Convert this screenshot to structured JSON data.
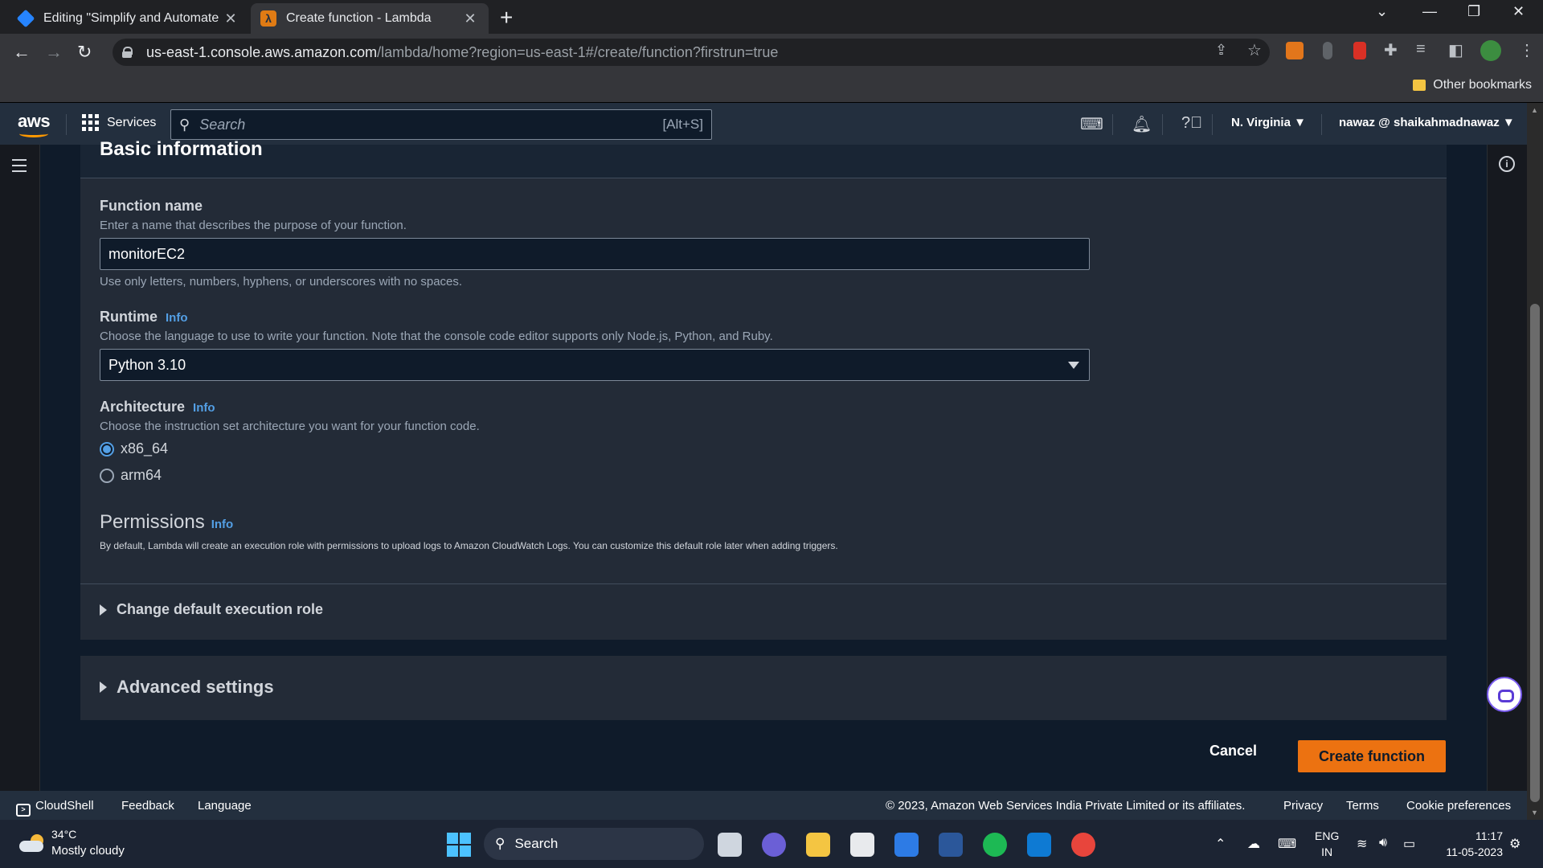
{
  "browser": {
    "tabs": [
      {
        "label": "Editing \"Simplify and Automate /",
        "active": false,
        "favicon": "confluence-icon"
      },
      {
        "label": "Create function - Lambda",
        "active": true,
        "favicon": "lambda-icon"
      }
    ],
    "url_host": "us-east-1.console.aws.amazon.com",
    "url_path": "/lambda/home?region=us-east-1#/create/function?firstrun=true",
    "bookmarks": {
      "other": "Other bookmarks"
    }
  },
  "aws_header": {
    "logo": "aws",
    "services": "Services",
    "search_placeholder": "Search",
    "search_shortcut": "[Alt+S]",
    "region": "N. Virginia",
    "account": "nawaz @ shaikahmadnawaz"
  },
  "form": {
    "section_title": "Basic information",
    "function_name": {
      "label": "Function name",
      "description": "Enter a name that describes the purpose of your function.",
      "value": "monitorEC2",
      "constraint": "Use only letters, numbers, hyphens, or underscores with no spaces."
    },
    "runtime": {
      "label": "Runtime",
      "info": "Info",
      "description": "Choose the language to use to write your function. Note that the console code editor supports only Node.js, Python, and Ruby.",
      "value": "Python 3.10"
    },
    "architecture": {
      "label": "Architecture",
      "info": "Info",
      "description": "Choose the instruction set architecture you want for your function code.",
      "options": [
        {
          "label": "x86_64",
          "selected": true
        },
        {
          "label": "arm64",
          "selected": false
        }
      ]
    },
    "permissions": {
      "title": "Permissions",
      "info": "Info",
      "description": "By default, Lambda will create an execution role with permissions to upload logs to Amazon CloudWatch Logs. You can customize this default role later when adding triggers.",
      "expander": "Change default execution role"
    },
    "advanced": "Advanced settings",
    "cancel": "Cancel",
    "create": "Create function"
  },
  "footer": {
    "cloudshell": "CloudShell",
    "feedback": "Feedback",
    "language": "Language",
    "copyright": "© 2023, Amazon Web Services India Private Limited or its affiliates.",
    "privacy": "Privacy",
    "terms": "Terms",
    "cookies": "Cookie preferences"
  },
  "taskbar": {
    "temperature": "34°C",
    "weather": "Mostly cloudy",
    "search": "Search",
    "lang_top": "ENG",
    "lang_bottom": "IN",
    "time": "11:17",
    "date": "11-05-2023"
  },
  "colors": {
    "aws_orange": "#ec7211",
    "info_link": "#539fe5",
    "header_bg": "#232f3e",
    "page_bg": "#0f1b2a"
  }
}
